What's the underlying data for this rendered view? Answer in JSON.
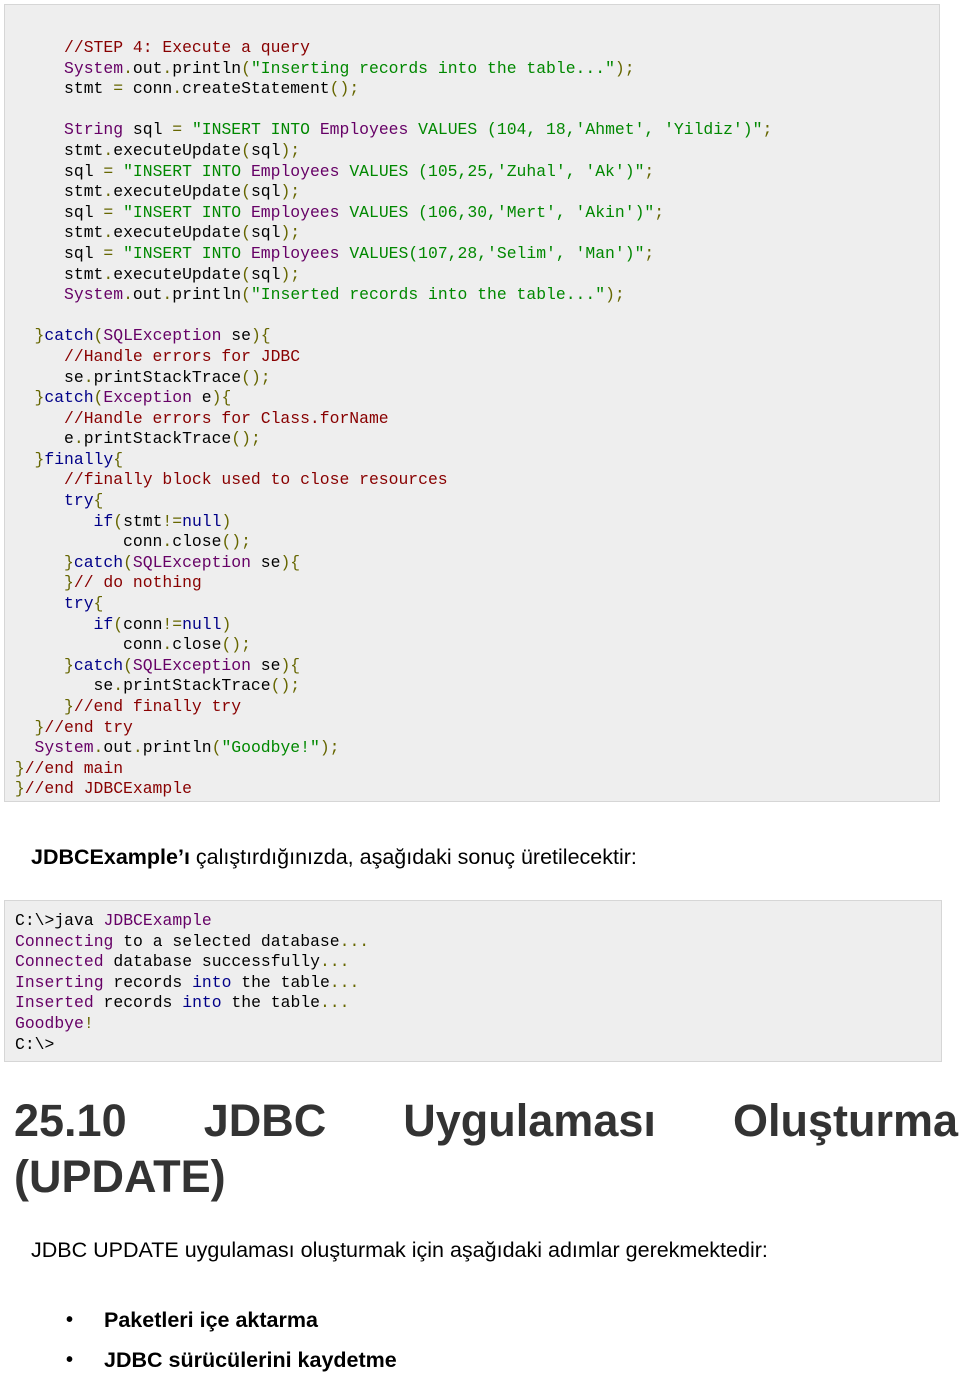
{
  "code_block": {
    "lines": [
      [
        [
          "",
          "      "
        ],
        [
          "c-com",
          "//STEP 4: Execute a query"
        ]
      ],
      [
        [
          "",
          "      "
        ],
        [
          "c-typ",
          "System"
        ],
        [
          "c-pun",
          "."
        ],
        [
          "c-pln",
          "out"
        ],
        [
          "c-pun",
          "."
        ],
        [
          "c-pln",
          "println"
        ],
        [
          "c-pun",
          "("
        ],
        [
          "c-str",
          "\"Inserting records into the table...\""
        ],
        [
          "c-pun",
          ");"
        ]
      ],
      [
        [
          "",
          "      "
        ],
        [
          "c-pln",
          "stmt "
        ],
        [
          "c-pun",
          "="
        ],
        [
          "c-pln",
          " conn"
        ],
        [
          "c-pun",
          "."
        ],
        [
          "c-pln",
          "createStatement"
        ],
        [
          "c-pun",
          "();"
        ]
      ],
      [
        [
          "",
          ""
        ]
      ],
      [
        [
          "",
          "      "
        ],
        [
          "c-typ",
          "String"
        ],
        [
          "c-pln",
          " sql "
        ],
        [
          "c-pun",
          "="
        ],
        [
          "c-pln",
          " "
        ],
        [
          "c-str",
          "\"INSERT INTO "
        ],
        [
          "c-typ",
          "Employees"
        ],
        [
          "c-str",
          " VALUES (104, 18,'Ahmet', 'Yildiz')\""
        ],
        [
          "c-pun",
          ";"
        ]
      ],
      [
        [
          "",
          "      "
        ],
        [
          "c-pln",
          "stmt"
        ],
        [
          "c-pun",
          "."
        ],
        [
          "c-pln",
          "executeUpdate"
        ],
        [
          "c-pun",
          "("
        ],
        [
          "c-pln",
          "sql"
        ],
        [
          "c-pun",
          ");"
        ]
      ],
      [
        [
          "",
          "      "
        ],
        [
          "c-pln",
          "sql "
        ],
        [
          "c-pun",
          "="
        ],
        [
          "c-pln",
          " "
        ],
        [
          "c-str",
          "\"INSERT INTO "
        ],
        [
          "c-typ",
          "Employees"
        ],
        [
          "c-str",
          " VALUES (105,25,'Zuhal', 'Ak')\""
        ],
        [
          "c-pun",
          ";"
        ]
      ],
      [
        [
          "",
          "      "
        ],
        [
          "c-pln",
          "stmt"
        ],
        [
          "c-pun",
          "."
        ],
        [
          "c-pln",
          "executeUpdate"
        ],
        [
          "c-pun",
          "("
        ],
        [
          "c-pln",
          "sql"
        ],
        [
          "c-pun",
          ");"
        ]
      ],
      [
        [
          "",
          "      "
        ],
        [
          "c-pln",
          "sql "
        ],
        [
          "c-pun",
          "="
        ],
        [
          "c-pln",
          " "
        ],
        [
          "c-str",
          "\"INSERT INTO "
        ],
        [
          "c-typ",
          "Employees"
        ],
        [
          "c-str",
          " VALUES (106,30,'Mert', 'Akin')\""
        ],
        [
          "c-pun",
          ";"
        ]
      ],
      [
        [
          "",
          "      "
        ],
        [
          "c-pln",
          "stmt"
        ],
        [
          "c-pun",
          "."
        ],
        [
          "c-pln",
          "executeUpdate"
        ],
        [
          "c-pun",
          "("
        ],
        [
          "c-pln",
          "sql"
        ],
        [
          "c-pun",
          ");"
        ]
      ],
      [
        [
          "",
          "      "
        ],
        [
          "c-pln",
          "sql "
        ],
        [
          "c-pun",
          "="
        ],
        [
          "c-pln",
          " "
        ],
        [
          "c-str",
          "\"INSERT INTO "
        ],
        [
          "c-typ",
          "Employees"
        ],
        [
          "c-str",
          " VALUES(107,28,'Selim', 'Man')\""
        ],
        [
          "c-pun",
          ";"
        ]
      ],
      [
        [
          "",
          "      "
        ],
        [
          "c-pln",
          "stmt"
        ],
        [
          "c-pun",
          "."
        ],
        [
          "c-pln",
          "executeUpdate"
        ],
        [
          "c-pun",
          "("
        ],
        [
          "c-pln",
          "sql"
        ],
        [
          "c-pun",
          ");"
        ]
      ],
      [
        [
          "",
          "      "
        ],
        [
          "c-typ",
          "System"
        ],
        [
          "c-pun",
          "."
        ],
        [
          "c-pln",
          "out"
        ],
        [
          "c-pun",
          "."
        ],
        [
          "c-pln",
          "println"
        ],
        [
          "c-pun",
          "("
        ],
        [
          "c-str",
          "\"Inserted records into the table...\""
        ],
        [
          "c-pun",
          ");"
        ]
      ],
      [
        [
          "",
          ""
        ]
      ],
      [
        [
          "",
          "   "
        ],
        [
          "c-pun",
          "}"
        ],
        [
          "c-kw",
          "catch"
        ],
        [
          "c-pun",
          "("
        ],
        [
          "c-typ",
          "SQLException"
        ],
        [
          "c-pln",
          " se"
        ],
        [
          "c-pun",
          "){"
        ]
      ],
      [
        [
          "",
          "      "
        ],
        [
          "c-com",
          "//Handle errors for JDBC"
        ]
      ],
      [
        [
          "",
          "      "
        ],
        [
          "c-pln",
          "se"
        ],
        [
          "c-pun",
          "."
        ],
        [
          "c-pln",
          "printStackTrace"
        ],
        [
          "c-pun",
          "();"
        ]
      ],
      [
        [
          "",
          "   "
        ],
        [
          "c-pun",
          "}"
        ],
        [
          "c-kw",
          "catch"
        ],
        [
          "c-pun",
          "("
        ],
        [
          "c-typ",
          "Exception"
        ],
        [
          "c-pln",
          " e"
        ],
        [
          "c-pun",
          "){"
        ]
      ],
      [
        [
          "",
          "      "
        ],
        [
          "c-com",
          "//Handle errors for Class.forName"
        ]
      ],
      [
        [
          "",
          "      "
        ],
        [
          "c-pln",
          "e"
        ],
        [
          "c-pun",
          "."
        ],
        [
          "c-pln",
          "printStackTrace"
        ],
        [
          "c-pun",
          "();"
        ]
      ],
      [
        [
          "",
          "   "
        ],
        [
          "c-pun",
          "}"
        ],
        [
          "c-kw",
          "finally"
        ],
        [
          "c-pun",
          "{"
        ]
      ],
      [
        [
          "",
          "      "
        ],
        [
          "c-com",
          "//finally block used to close resources"
        ]
      ],
      [
        [
          "",
          "      "
        ],
        [
          "c-kw",
          "try"
        ],
        [
          "c-pun",
          "{"
        ]
      ],
      [
        [
          "",
          "         "
        ],
        [
          "c-kw",
          "if"
        ],
        [
          "c-pun",
          "("
        ],
        [
          "c-pln",
          "stmt"
        ],
        [
          "c-pun",
          "!="
        ],
        [
          "c-kw",
          "null"
        ],
        [
          "c-pun",
          ")"
        ]
      ],
      [
        [
          "",
          "            "
        ],
        [
          "c-pln",
          "conn"
        ],
        [
          "c-pun",
          "."
        ],
        [
          "c-pln",
          "close"
        ],
        [
          "c-pun",
          "();"
        ]
      ],
      [
        [
          "",
          "      "
        ],
        [
          "c-pun",
          "}"
        ],
        [
          "c-kw",
          "catch"
        ],
        [
          "c-pun",
          "("
        ],
        [
          "c-typ",
          "SQLException"
        ],
        [
          "c-pln",
          " se"
        ],
        [
          "c-pun",
          "){"
        ]
      ],
      [
        [
          "",
          "      "
        ],
        [
          "c-pun",
          "}"
        ],
        [
          "c-com",
          "// do nothing"
        ]
      ],
      [
        [
          "",
          "      "
        ],
        [
          "c-kw",
          "try"
        ],
        [
          "c-pun",
          "{"
        ]
      ],
      [
        [
          "",
          "         "
        ],
        [
          "c-kw",
          "if"
        ],
        [
          "c-pun",
          "("
        ],
        [
          "c-pln",
          "conn"
        ],
        [
          "c-pun",
          "!="
        ],
        [
          "c-kw",
          "null"
        ],
        [
          "c-pun",
          ")"
        ]
      ],
      [
        [
          "",
          "            "
        ],
        [
          "c-pln",
          "conn"
        ],
        [
          "c-pun",
          "."
        ],
        [
          "c-pln",
          "close"
        ],
        [
          "c-pun",
          "();"
        ]
      ],
      [
        [
          "",
          "      "
        ],
        [
          "c-pun",
          "}"
        ],
        [
          "c-kw",
          "catch"
        ],
        [
          "c-pun",
          "("
        ],
        [
          "c-typ",
          "SQLException"
        ],
        [
          "c-pln",
          " se"
        ],
        [
          "c-pun",
          "){"
        ]
      ],
      [
        [
          "",
          "         "
        ],
        [
          "c-pln",
          "se"
        ],
        [
          "c-pun",
          "."
        ],
        [
          "c-pln",
          "printStackTrace"
        ],
        [
          "c-pun",
          "();"
        ]
      ],
      [
        [
          "",
          "      "
        ],
        [
          "c-pun",
          "}"
        ],
        [
          "c-com",
          "//end finally try"
        ]
      ],
      [
        [
          "",
          "   "
        ],
        [
          "c-pun",
          "}"
        ],
        [
          "c-com",
          "//end try"
        ]
      ],
      [
        [
          "",
          "   "
        ],
        [
          "c-typ",
          "System"
        ],
        [
          "c-pun",
          "."
        ],
        [
          "c-pln",
          "out"
        ],
        [
          "c-pun",
          "."
        ],
        [
          "c-pln",
          "println"
        ],
        [
          "c-pun",
          "("
        ],
        [
          "c-str",
          "\"Goodbye!\""
        ],
        [
          "c-pun",
          ");"
        ]
      ],
      [
        [
          "",
          " "
        ],
        [
          "c-pun",
          "}"
        ],
        [
          "c-com",
          "//end main"
        ]
      ],
      [
        [
          "",
          " "
        ],
        [
          "c-pun",
          "}"
        ],
        [
          "c-com",
          "//end JDBCExample"
        ]
      ]
    ]
  },
  "intro": {
    "bold": "JDBCExample’ı",
    "rest": " çalıştırdığınızda, aşağıdaki sonuç üretilecektir:"
  },
  "output_block": {
    "lines": [
      [
        [
          "c-pln",
          "C:\\>java "
        ],
        [
          "c-typ",
          "JDBCExample"
        ]
      ],
      [
        [
          "c-typ",
          "Connecting"
        ],
        [
          "c-pln",
          " to a selected database"
        ],
        [
          "c-pun",
          "..."
        ]
      ],
      [
        [
          "c-typ",
          "Connected"
        ],
        [
          "c-pln",
          " database successfully"
        ],
        [
          "c-pun",
          "..."
        ]
      ],
      [
        [
          "c-typ",
          "Inserting"
        ],
        [
          "c-pln",
          " records "
        ],
        [
          "c-kw",
          "into"
        ],
        [
          "c-pln",
          " the table"
        ],
        [
          "c-pun",
          "..."
        ]
      ],
      [
        [
          "c-typ",
          "Inserted"
        ],
        [
          "c-pln",
          " records "
        ],
        [
          "c-kw",
          "into"
        ],
        [
          "c-pln",
          " the table"
        ],
        [
          "c-pun",
          "..."
        ]
      ],
      [
        [
          "c-typ",
          "Goodbye"
        ],
        [
          "c-pun",
          "!"
        ]
      ],
      [
        [
          "c-pln",
          "C:\\>"
        ]
      ]
    ]
  },
  "heading": {
    "words_line1": [
      "25.10",
      "JDBC",
      "Uygulaması",
      "Oluşturma"
    ],
    "line2": "(UPDATE)"
  },
  "paragraph": "JDBC UPDATE uygulaması oluşturmak için aşağıdaki adımlar gerekmektedir:",
  "steps": [
    {
      "bullet": "•",
      "label": "Paketleri içe aktarma"
    },
    {
      "bullet": "•",
      "label": "JDBC sürücülerini kaydetme"
    }
  ]
}
